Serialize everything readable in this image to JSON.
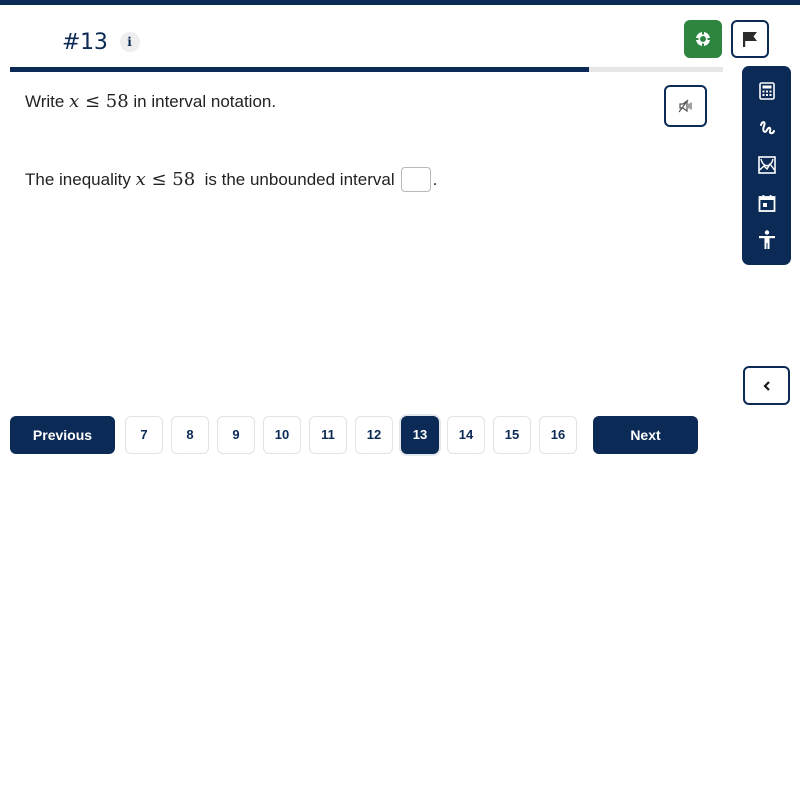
{
  "header": {
    "question_number": "#13",
    "info_icon": "info-icon",
    "info_label": "i"
  },
  "actions": {
    "help_icon": "lifebuoy-icon",
    "flag_icon": "flag-icon"
  },
  "progress": {
    "current": 13,
    "total": 16,
    "fraction": 0.8125
  },
  "question": {
    "prompt_prefix": "Write ",
    "prompt_math_var": "x",
    "prompt_math_op": " ≤ ",
    "prompt_math_num": "58",
    "prompt_suffix": " in interval notation.",
    "statement_prefix": "The inequality ",
    "statement_math_var": "x",
    "statement_math_op": " ≤ ",
    "statement_math_num": "58",
    "statement_middle": "  is the unbounded interval",
    "statement_suffix": ".",
    "answer_value": ""
  },
  "audio": {
    "icon": "speaker-muted-icon"
  },
  "tools": [
    {
      "name": "calculator",
      "icon": "calculator-icon"
    },
    {
      "name": "scratchpad",
      "icon": "scribble-icon"
    },
    {
      "name": "graphing",
      "icon": "graph-icon"
    },
    {
      "name": "calendar",
      "icon": "calendar-icon"
    },
    {
      "name": "accessibility",
      "icon": "accessibility-icon"
    }
  ],
  "sidebar": {
    "collapse_icon": "chevron-left-icon"
  },
  "pagination": {
    "previous_label": "Previous",
    "next_label": "Next",
    "pages": [
      "7",
      "8",
      "9",
      "10",
      "11",
      "12",
      "13",
      "14",
      "15",
      "16"
    ],
    "current_page": "13"
  },
  "colors": {
    "primary": "#0b2a55",
    "help_green": "#2e8540",
    "progress_track": "#e6e6e6"
  }
}
